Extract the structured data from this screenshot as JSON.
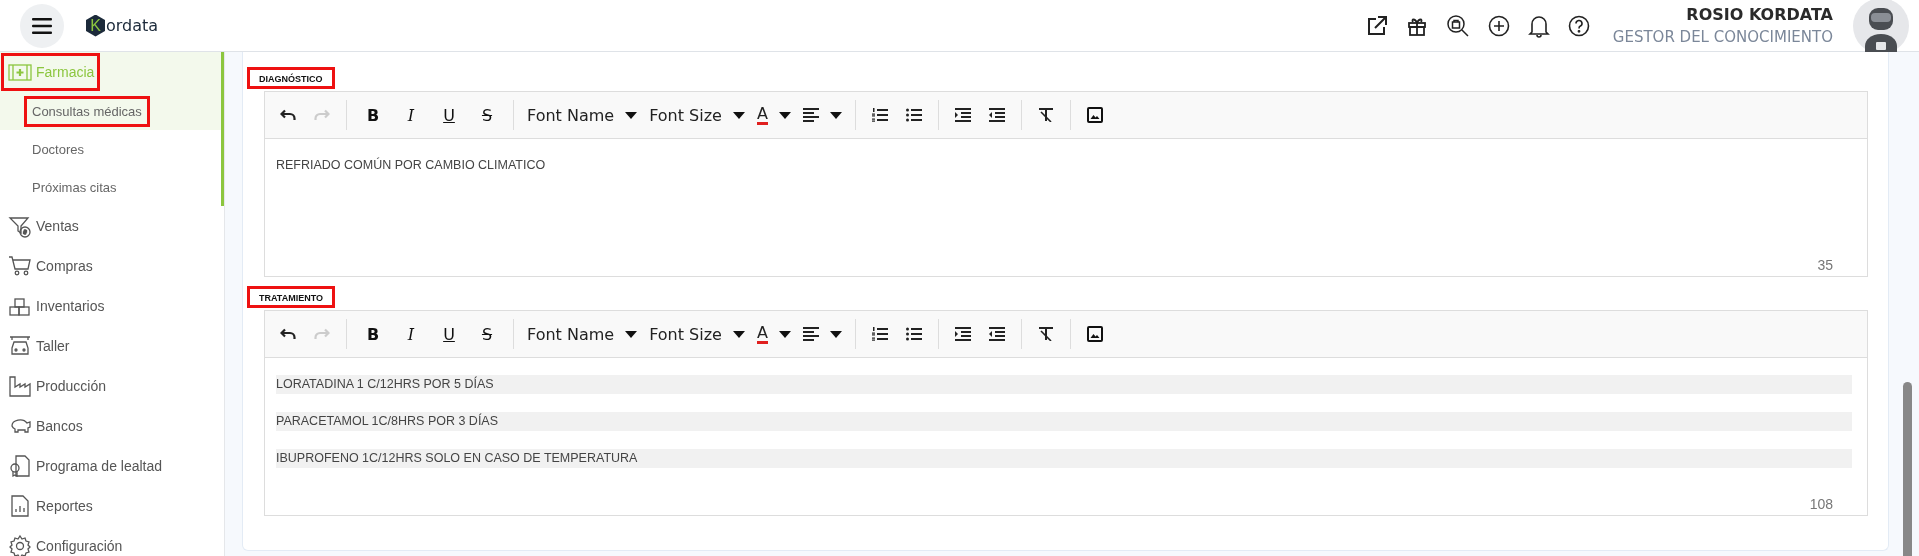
{
  "header": {
    "logo": {
      "mark": "K",
      "text": "ordata"
    },
    "user": {
      "name": "ROSIO KORDATA",
      "role": "GESTOR DEL CONOCIMIENTO"
    }
  },
  "sidebar": {
    "items": [
      {
        "label": "Farmacia",
        "selected": true,
        "highlighted": true,
        "expanded": true,
        "children": [
          {
            "label": "Consultas médicas",
            "selected": true,
            "highlighted": true
          },
          {
            "label": "Doctores",
            "selected": false,
            "highlighted": false
          },
          {
            "label": "Próximas citas",
            "selected": false,
            "highlighted": false
          }
        ]
      },
      {
        "label": "Ventas",
        "selected": false,
        "highlighted": false
      },
      {
        "label": "Compras",
        "selected": false,
        "highlighted": false
      },
      {
        "label": "Inventarios",
        "selected": false,
        "highlighted": false
      },
      {
        "label": "Taller",
        "selected": false,
        "highlighted": false
      },
      {
        "label": "Producción",
        "selected": false,
        "highlighted": false
      },
      {
        "label": "Bancos",
        "selected": false,
        "highlighted": false
      },
      {
        "label": "Programa de lealtad",
        "selected": false,
        "highlighted": false
      },
      {
        "label": "Reportes",
        "selected": false,
        "highlighted": false
      },
      {
        "label": "Configuración",
        "selected": false,
        "highlighted": false
      }
    ]
  },
  "editors": [
    {
      "label": "DIAGNÓSTICO",
      "highlighted": true,
      "toolbar": {
        "undo_disabled": false,
        "redo_disabled": true,
        "format": [
          {
            "kind": "bold",
            "glyph": "B"
          },
          {
            "kind": "italic",
            "glyph": "I"
          },
          {
            "kind": "underline",
            "glyph": "U"
          },
          {
            "kind": "strike",
            "glyph": "S"
          }
        ],
        "font_name": "Font Name",
        "font_size": "Font Size",
        "color_glyph": "A"
      },
      "lines": [
        {
          "text": "REFRIADO COMÚN POR CAMBIO CLIMATICO",
          "shaded": false
        }
      ],
      "count": "35"
    },
    {
      "label": "TRATAMIENTO",
      "highlighted": true,
      "toolbar": {
        "undo_disabled": false,
        "redo_disabled": true,
        "format": [
          {
            "kind": "bold",
            "glyph": "B"
          },
          {
            "kind": "italic",
            "glyph": "I"
          },
          {
            "kind": "underline",
            "glyph": "U"
          },
          {
            "kind": "strike",
            "glyph": "S"
          }
        ],
        "font_name": "Font Name",
        "font_size": "Font Size",
        "color_glyph": "A"
      },
      "lines": [
        {
          "text": "LORATADINA 1 C/12HRS POR 5 DÍAS",
          "shaded": true
        },
        {
          "text": "PARACETAMOL 1C/8HRS POR 3 DÍAS",
          "shaded": true
        },
        {
          "text": "IBUPROFENO 1C/12HRS SOLO EN CASO DE TEMPERATURA",
          "shaded": true
        }
      ],
      "count": "108"
    }
  ]
}
